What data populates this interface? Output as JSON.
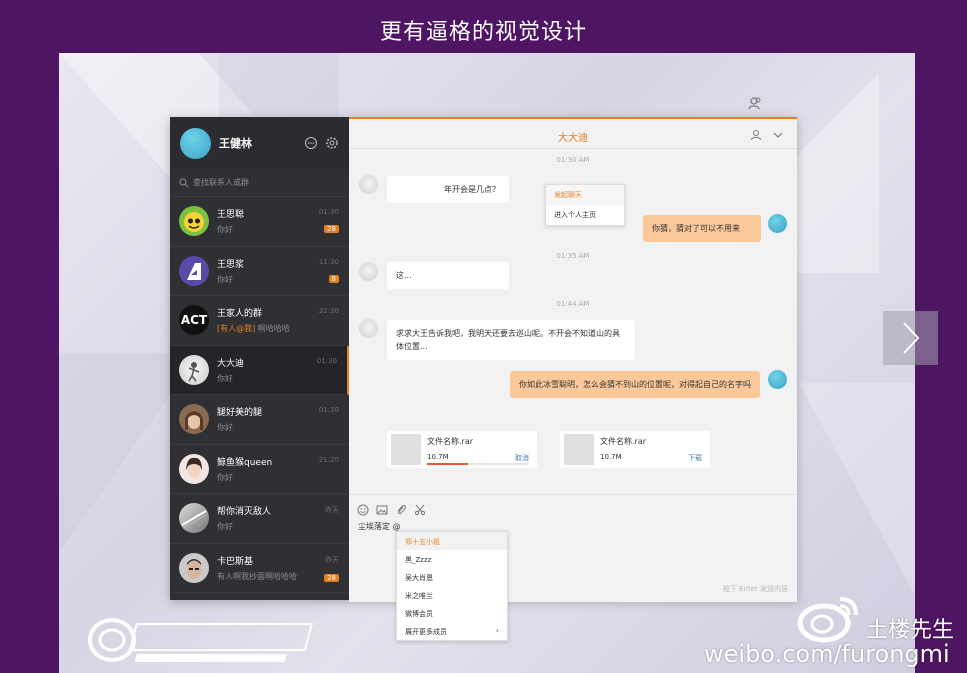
{
  "headline": "更有逼格的视觉设计",
  "colors": {
    "accent": "#e67e22",
    "sidebar": "#2f3034",
    "bubble_out": "#fbc89a",
    "page_bg": "#4e1563"
  },
  "profile": {
    "name": "王健林",
    "icons": [
      "chat-bubble-icon",
      "gear-icon"
    ]
  },
  "search": {
    "placeholder": "查找联系人或群"
  },
  "contacts": [
    {
      "name": "王思聪",
      "msg": "你好",
      "time": "01:30",
      "badge": "28"
    },
    {
      "name": "王思浆",
      "msg": "你好",
      "time": "11:30",
      "badge": "8"
    },
    {
      "name": "王家人的群",
      "tag": "[有人@我]",
      "msg": "啊哈哈哈",
      "time": "22:30"
    },
    {
      "name": "大大迪",
      "msg": "你好",
      "time": "01:30"
    },
    {
      "name": "腿好美的腿",
      "msg": "你好",
      "time": "01:30"
    },
    {
      "name": "鲸鱼猴queen",
      "msg": "你好",
      "time": "21:20"
    },
    {
      "name": "帮你消灭敌人",
      "msg": "你好",
      "time": "昨天"
    },
    {
      "name": "卡巴斯基",
      "msg": "有人啊我抄面啊哈哈哈",
      "time": "昨天",
      "badge": "28"
    }
  ],
  "chat": {
    "title": "大大迪",
    "timestamps": [
      "01:30 AM",
      "01:35 AM",
      "01:44 AM"
    ],
    "messages": [
      {
        "dir": "in",
        "text": "年开会是几点？"
      },
      {
        "dir": "out",
        "text": "你猜，猜对了可以不用来"
      },
      {
        "dir": "in",
        "text": "这..."
      },
      {
        "dir": "in",
        "text": "求求大王告诉我吧，我明天还要去巡山呢。不开会不知道山的具体位置..."
      },
      {
        "dir": "out",
        "text": "你如此冰雪聪明，怎么会猜不到山的位置呢，对得起自己的名字吗"
      }
    ],
    "files": [
      {
        "name": "文件名称.rar",
        "size": "10.7M",
        "action": "取消",
        "progress": 0.4
      },
      {
        "name": "文件名称.rar",
        "size": "10.7M",
        "action": "下载"
      }
    ],
    "context_menu": [
      "发起聊天",
      "进入个人主页"
    ],
    "typed": "尘埃落定 @",
    "hint": "按下 Enter 发送内容"
  },
  "mention_list": [
    "郑十五小姐",
    "黑_Zzzz",
    "吴大肖恩",
    "米之唯兰",
    "微博会员",
    "展开更多成员"
  ],
  "watermarks": {
    "weibo_name": "土楼先生",
    "weibo_url": "weibo.com/furongmi"
  }
}
